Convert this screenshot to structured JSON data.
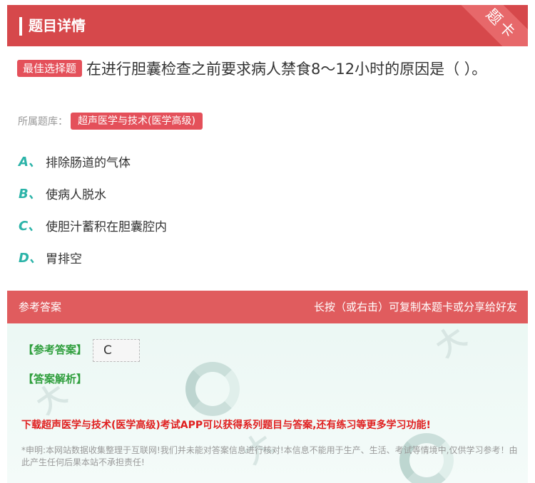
{
  "header": {
    "title": "题目详情",
    "ribbon": "题卡"
  },
  "question": {
    "tag": "最佳选择题",
    "text": "在进行胆囊检查之前要求病人禁食8～12小时的原因是（ ）。"
  },
  "category": {
    "label": "所属题库：",
    "value": "超声医学与技术(医学高级)"
  },
  "options": [
    {
      "letter": "A、",
      "text": "排除肠道的气体"
    },
    {
      "letter": "B、",
      "text": "使病人脱水"
    },
    {
      "letter": "C、",
      "text": "使胆汁蓄积在胆囊腔内"
    },
    {
      "letter": "D、",
      "text": "胃排空"
    }
  ],
  "answer_panel": {
    "title": "参考答案",
    "hint": "长按（或右击）可复制本题卡或分享给好友",
    "ref_label": "【参考答案】",
    "ref_value": "C",
    "analysis_label": "【答案解析】",
    "download_tip": "下载超声医学与技术(医学高级)考试APP可以获得系列题目与答案,还有练习等更多学习功能!",
    "disclaimer": "*申明:本网站数据收集整理于互联网!我们并未能对答案信息进行核对!本信息不能用于生产、生活、考试等情境中,仅供学习参考！由此产生任何后果本站不承担责任!"
  },
  "colors": {
    "header_red": "#d6484b",
    "option_teal": "#2bb3a8",
    "answer_green": "#2e9e3c",
    "tip_red": "#e02020"
  }
}
